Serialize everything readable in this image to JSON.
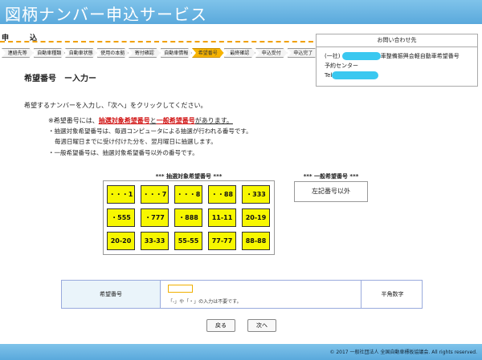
{
  "header": {
    "title": "図柄ナンバー申込サービス"
  },
  "apply": {
    "label_a": "申",
    "label_b": "込"
  },
  "steps": [
    {
      "label": "連絡先等",
      "active": false
    },
    {
      "label": "自動車種類",
      "active": false
    },
    {
      "label": "自動車状態",
      "active": false
    },
    {
      "label": "使用の本拠",
      "active": false
    },
    {
      "label": "寄付確認",
      "active": false
    },
    {
      "label": "自動車情報",
      "active": false
    },
    {
      "label": "希望番号",
      "active": true
    },
    {
      "label": "最終確認",
      "active": false
    },
    {
      "label": "申込受付",
      "active": false
    },
    {
      "label": "申込完了",
      "active": false
    }
  ],
  "contact": {
    "title": "お問い合わせ先",
    "org_prefix": "(一社)",
    "org_suffix": "車整備振興会軽自動車希望番号",
    "center": "予約センター",
    "tel_label": "Tel"
  },
  "section": {
    "title": "希望番号　ー入力ー"
  },
  "instruction": "希望するナンバーを入力し、「次へ」をクリックしてください。",
  "note": {
    "prefix": "※希望番号には、",
    "red1": "抽選対象希望番号",
    "mid": "と",
    "red2": "一般希望番号",
    "suffix": "があります。"
  },
  "bullets": {
    "b1": "・抽選対象希望番号は、毎週コンピュータによる抽選が行われる番号です。",
    "b2": "毎週日曜日までに受け付けた分を、翌月曜日に抽選します。",
    "b3": "・一般希望番号は、抽選対象希望番号以外の番号です。"
  },
  "lottery": {
    "title": "*** 抽選対象希望番号 ***",
    "numbers": [
      [
        "・・・1",
        "・・・7",
        "・・・8",
        "・・88",
        "・333"
      ],
      [
        "・555",
        "・777",
        "・888",
        "11-11",
        "20-19"
      ],
      [
        "20-20",
        "33-33",
        "55-55",
        "77-77",
        "88-88"
      ]
    ]
  },
  "general": {
    "title": "*** 一般希望番号 ***",
    "text": "左記番号以外"
  },
  "form": {
    "label": "希望番号",
    "value": "",
    "hint": "「-」や「・」の入力は不要です。",
    "side": "半角数字"
  },
  "buttons": {
    "back": "戻る",
    "next": "次へ"
  },
  "footer": {
    "text": "© 2017 一般社団法人 全国自動車標板協議会. All rights reserved."
  }
}
